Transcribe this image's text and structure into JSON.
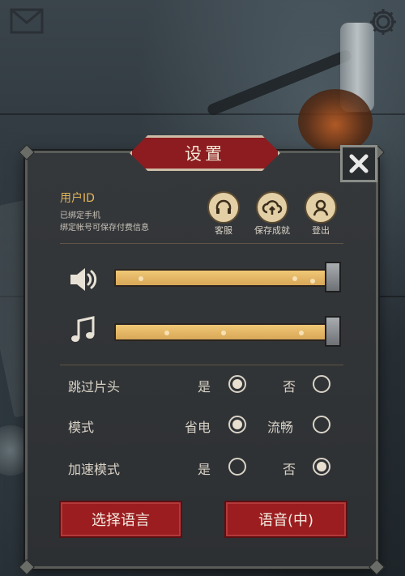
{
  "dialog": {
    "title": "设置",
    "close_icon": "close-icon"
  },
  "user": {
    "id_label": "用户ID",
    "line1": "已绑定手机",
    "line2": "绑定帐号可保存付费信息"
  },
  "account_buttons": [
    {
      "label": "客服",
      "icon": "headset-icon"
    },
    {
      "label": "保存成就",
      "icon": "cloud-upload-icon"
    },
    {
      "label": "登出",
      "icon": "user-icon"
    }
  ],
  "audio": {
    "sound_volume": 1.0,
    "music_volume": 1.0,
    "sound_icon": "speaker-icon",
    "music_icon": "music-note-icon"
  },
  "options": [
    {
      "label": "跳过片头",
      "choice_a": "是",
      "choice_b": "否",
      "selected": "a"
    },
    {
      "label": "模式",
      "choice_a": "省电",
      "choice_b": "流畅",
      "selected": "a"
    },
    {
      "label": "加速模式",
      "choice_a": "是",
      "choice_b": "否",
      "selected": "b"
    }
  ],
  "buttons": {
    "language": "选择语言",
    "voice": "语音(中)"
  },
  "colors": {
    "accent_red": "#9b1d20",
    "slider_gold": "#e5b96a",
    "label_gold": "#e1b559"
  }
}
